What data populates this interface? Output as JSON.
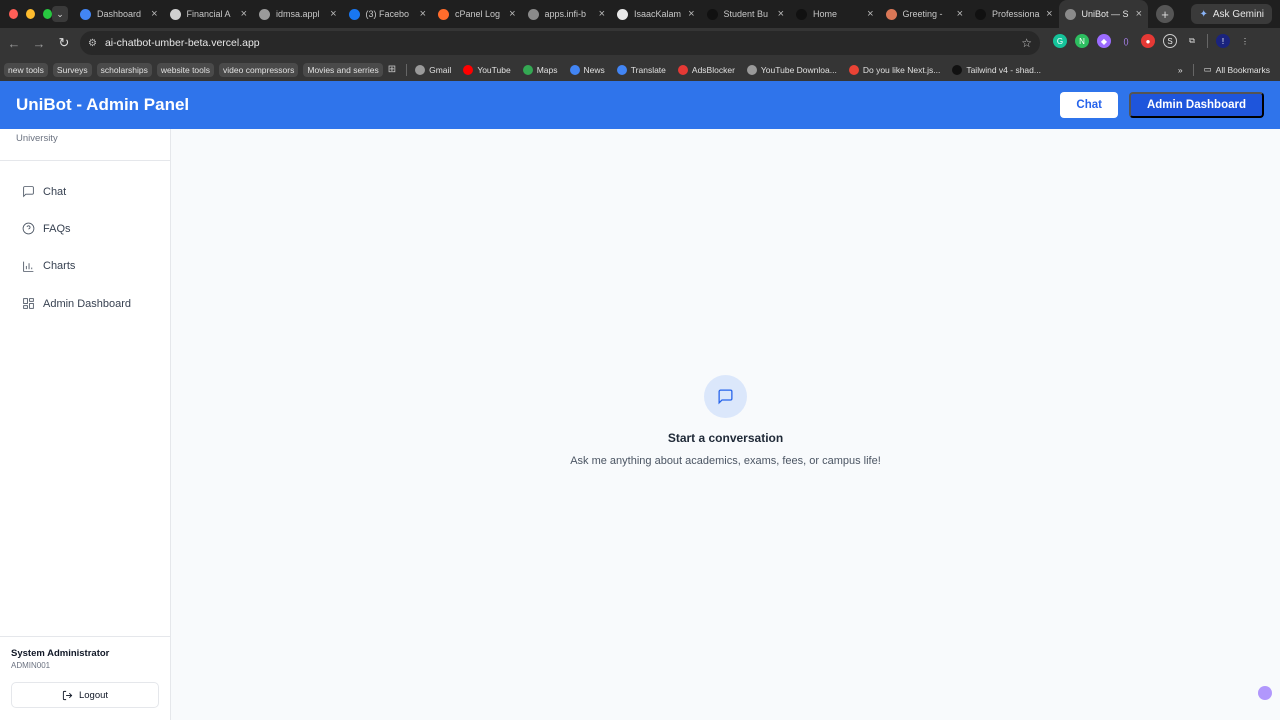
{
  "browser": {
    "tabs": [
      {
        "title": "Dashboard",
        "icon": "play-icon",
        "color": "#4285f4"
      },
      {
        "title": "Financial A",
        "icon": "document-icon",
        "color": "#cfcfcf"
      },
      {
        "title": "idmsa.appl",
        "icon": "apple-icon",
        "color": "#9a9a9a"
      },
      {
        "title": "(3) Facebo",
        "icon": "facebook-icon",
        "color": "#1877f2"
      },
      {
        "title": "cPanel Log",
        "icon": "cpanel-icon",
        "color": "#ff6c2c"
      },
      {
        "title": "apps.infi-b",
        "icon": "globe-icon",
        "color": "#8a8a8a"
      },
      {
        "title": "IsaacKalam",
        "icon": "github-icon",
        "color": "#e8e8e8"
      },
      {
        "title": "Student Bu",
        "icon": "vercel-icon",
        "color": "#111111"
      },
      {
        "title": "Home",
        "icon": "vercel-icon",
        "color": "#111111"
      },
      {
        "title": "Greeting -",
        "icon": "claude-icon",
        "color": "#d97757"
      },
      {
        "title": "Professiona",
        "icon": "vercel-icon",
        "color": "#111111"
      },
      {
        "title": "UniBot — S",
        "icon": "globe-icon",
        "color": "#8a8a8a",
        "active": true
      }
    ],
    "ask_gemini": "Ask Gemini",
    "url": "ai-chatbot-umber-beta.vercel.app",
    "bookmark_folders": [
      "new tools",
      "Surveys",
      "scholarships",
      "website tools",
      "video compressors",
      "Movies and serries"
    ],
    "bookmarks": [
      {
        "label": "Gmail",
        "color": "#9a9a9a"
      },
      {
        "label": "YouTube",
        "color": "#ff0000"
      },
      {
        "label": "Maps",
        "color": "#34a853"
      },
      {
        "label": "News",
        "color": "#4285f4"
      },
      {
        "label": "Translate",
        "color": "#4285f4"
      },
      {
        "label": "AdsBlocker",
        "color": "#e53935"
      },
      {
        "label": "YouTube Downloa...",
        "color": "#9a9a9a"
      },
      {
        "label": "Do you like Next.js...",
        "color": "#ea4335"
      },
      {
        "label": "Tailwind v4 - shad...",
        "color": "#111111"
      }
    ],
    "all_bookmarks": "All Bookmarks"
  },
  "header": {
    "title": "UniBot - Admin Panel",
    "chat_button": "Chat",
    "admin_button": "Admin Dashboard"
  },
  "sidebar": {
    "university": "University",
    "items": [
      {
        "label": "Chat",
        "icon": "message-square-icon"
      },
      {
        "label": "FAQs",
        "icon": "help-circle-icon"
      },
      {
        "label": "Charts",
        "icon": "bar-chart-icon"
      },
      {
        "label": "Admin Dashboard",
        "icon": "grid-icon"
      }
    ],
    "user_name": "System Administrator",
    "user_id": "ADMIN001",
    "logout": "Logout"
  },
  "empty_state": {
    "title": "Start a conversation",
    "subtitle": "Ask me anything about academics, exams, fees, or campus life!"
  },
  "colors": {
    "header_bg": "#2f74eb",
    "admin_button_bg": "#1e55dc",
    "accent": "#2563eb"
  }
}
